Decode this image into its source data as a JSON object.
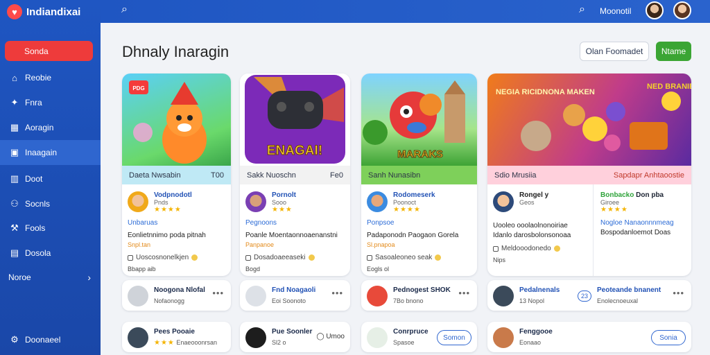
{
  "app": {
    "name": "Indiandixai",
    "logo_icon": "heart-logo-icon"
  },
  "sidebar": {
    "active_label": "Sonda",
    "items": [
      {
        "label": "Reobie",
        "icon": "home-icon"
      },
      {
        "label": "Fnra",
        "icon": "pin-icon"
      },
      {
        "label": "Aoragin",
        "icon": "grid-icon"
      },
      {
        "label": "Inaagain",
        "icon": "folder-icon"
      },
      {
        "label": "Doot",
        "icon": "chart-icon"
      },
      {
        "label": "Socnls",
        "icon": "share-icon"
      },
      {
        "label": "Fools",
        "icon": "tools-icon"
      },
      {
        "label": "Dosola",
        "icon": "calendar-icon"
      },
      {
        "label": "Noroe",
        "icon": "chevron-right-icon"
      }
    ],
    "footer_label": "Doonaeel"
  },
  "topbar": {
    "user_label": "Moonotil"
  },
  "page": {
    "title": "Dhnaly Inaragin",
    "btn_outline": "Olan Foomadet",
    "btn_primary": "Ntame"
  },
  "cards": [
    {
      "hero_tag": "PDG",
      "foot_left": "Daeta Nwsabin",
      "foot_right": "T00",
      "app_name": "Vodpnodotl",
      "app_sub": "Pnds",
      "blue": "Unbaruas",
      "dark": "Eonlietnnimo poda pitnah",
      "orange": "Snpl.tan",
      "check": "Uoscosnonelkjen",
      "small": "Bbapp aib"
    },
    {
      "hero_tag": "ENAGAI!",
      "foot_left": "Sakk Nuoschn",
      "foot_right": "Fe0",
      "app_name": "Pornolt",
      "app_sub": "Sooo",
      "blue": "Pegnoons",
      "dark": "Poanle Moentaonnoaenanstni",
      "orange": "Panpanoe",
      "check": "Dosadoaeeaseki",
      "small": "Bogd"
    },
    {
      "hero_tag": "MARAKS",
      "foot_left": "Sanh Nunasibn",
      "foot_right": "",
      "app_name": "Rodomeserk",
      "app_sub": "Poonoct",
      "blue": "Ponpsoe",
      "dark": "Padaponodn Paogaon Gorela",
      "orange": "Sl.pnapoa",
      "check": "Sasoaleoneo seak",
      "small": "Eogls ol"
    },
    {
      "hero_tag": "NEGIA RICIDNONA MAKEN",
      "hero_tag2": "NED BRANIES",
      "foot_left": "Sdio Mrusiia",
      "foot_right": "Sapdapr Anhtaoostie",
      "app_name": "Rongel y",
      "app_sub": "Geos",
      "blue": "",
      "dark": "Uooleo ooolaolnonoiriae",
      "orange": "",
      "dark2": "Idanlo darosbolonsonoaa",
      "check": "Meldooodonedo",
      "small": "Nips",
      "app_name2": "Bonbacko",
      "app_name2b": "Don pba",
      "app_sub2": "Giroee",
      "blue2": "Nogloe Nanaonnnmeag",
      "dark3": "Bospodanloemot Doas"
    }
  ],
  "minis_row1": [
    {
      "t1": "Noogona Nlofal",
      "t2": "Nofaonogg",
      "icon": "game-icon"
    },
    {
      "t1": "Fnd Noagaoli",
      "t2": "Eoi Soonoto",
      "icon": "gear-icon"
    },
    {
      "t1": "Pednogest SHOK",
      "t2": "7Bo bnono",
      "icon": "fire-icon"
    },
    {
      "t1": "Pedalnenals",
      "t2": "13 Nopol",
      "badge": "23",
      "t1b": "Peoteande bnanent",
      "t2b": "Enolecnoeuxal",
      "icon": "people-icon"
    }
  ],
  "minis_row2": [
    {
      "t1": "Pees Pooaie",
      "t2": "Enaeooonrsan",
      "icon": "game-icon"
    },
    {
      "t1": "Pue Soonler",
      "t2": "Sl2 o",
      "btn": "Umoo",
      "icon": "controller-icon"
    },
    {
      "t1": "Conrpruce",
      "t2": "Spasoe",
      "btn": "Somon",
      "icon": "people-icon"
    },
    {
      "t1": "Fenggooe",
      "t2": "Eonaao",
      "btn": "Sonia",
      "icon": "person-icon"
    }
  ],
  "colors": {
    "sidebar": "#1f56c2",
    "active": "#ee3b3b",
    "primary": "#3ba534",
    "link": "#2252b5"
  }
}
